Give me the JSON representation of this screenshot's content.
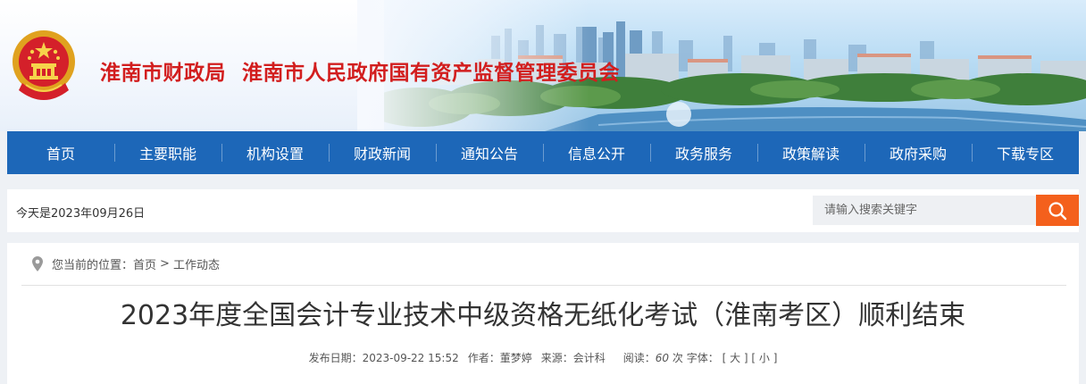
{
  "header": {
    "site_name_1": "淮南市财政局",
    "site_name_2": "淮南市人民政府国有资产监督管理委员会",
    "emblem_icon": "national-emblem-icon"
  },
  "nav": {
    "items": [
      "首页",
      "主要职能",
      "机构设置",
      "财政新闻",
      "通知公告",
      "信息公开",
      "政务服务",
      "政策解读",
      "政府采购",
      "下载专区"
    ]
  },
  "infobar": {
    "today_text": "今天是2023年09月26日",
    "search_placeholder": "请输入搜索关键字",
    "search_icon": "search-icon"
  },
  "breadcrumb": {
    "prefix": "您当前的位置：",
    "items": [
      "首页",
      "工作动态"
    ],
    "separator": ">",
    "icon": "location-pin-icon"
  },
  "article": {
    "title": "2023年度全国会计专业技术中级资格无纸化考试（淮南考区）顺利结束",
    "publish_label": "发布日期：",
    "publish_date": "2023-09-22 15:52",
    "author_label": "作者：",
    "author": "董梦婷",
    "source_label": "来源：",
    "source": "会计科",
    "views_label": "阅读：",
    "views": "60",
    "views_unit": "次",
    "font_label": "字体：",
    "font_large": "[ 大 ]",
    "font_small": "[ 小 ]"
  },
  "colors": {
    "nav_bg": "#1d67b8",
    "title_red": "#d21e1e",
    "search_btn": "#f4601c",
    "page_bg": "#eef1f5"
  }
}
